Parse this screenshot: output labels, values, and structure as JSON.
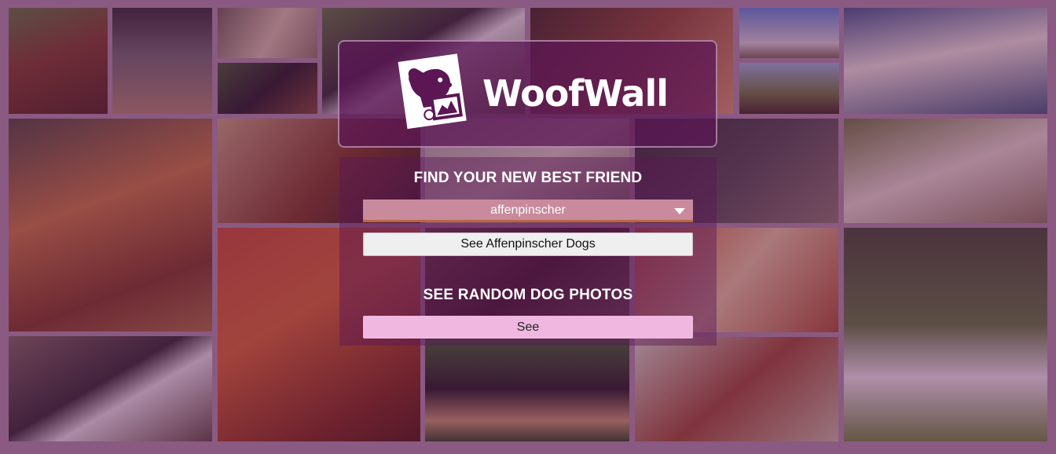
{
  "brand": {
    "name": "WoofWall",
    "logo_icon": "dog-photo-logo-icon"
  },
  "breed_section": {
    "heading": "FIND YOUR NEW BEST FRIEND",
    "selected_breed": "affenpinscher",
    "button_label": "See Affenpinscher Dogs"
  },
  "random_section": {
    "heading": "SEE RANDOM DOG PHOTOS",
    "button_label": "See"
  },
  "colors": {
    "overlay": "#5c1654",
    "select_bg": "#c98a9d",
    "select_border": "#b8683a",
    "random_button_bg": "#f0b8e0"
  }
}
